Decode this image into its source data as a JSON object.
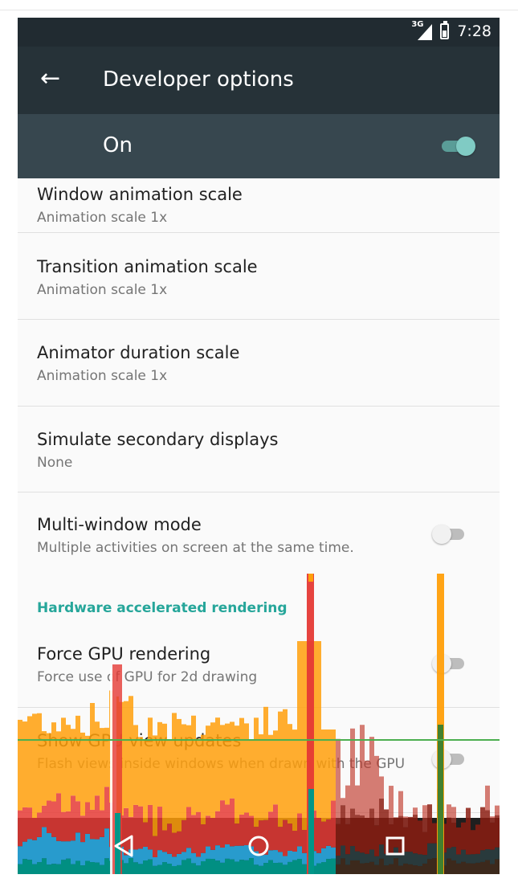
{
  "status_bar": {
    "network": "3G",
    "time": "7:28"
  },
  "app_bar": {
    "title": "Developer options",
    "back_icon": "arrow-back-icon"
  },
  "master_switch": {
    "label": "On",
    "state": "on"
  },
  "settings": [
    {
      "title": "Window animation scale",
      "subtitle": "Animation scale 1x"
    },
    {
      "title": "Transition animation scale",
      "subtitle": "Animation scale 1x"
    },
    {
      "title": "Animator duration scale",
      "subtitle": "Animation scale 1x"
    },
    {
      "title": "Simulate secondary displays",
      "subtitle": "None"
    },
    {
      "title": "Multi-window mode",
      "subtitle": "Multiple activities on screen at the same time.",
      "switch": "off"
    }
  ],
  "section_header": "Hardware accelerated rendering",
  "hw_settings": [
    {
      "title": "Force GPU rendering",
      "subtitle": "Force use of GPU for 2d drawing",
      "switch": "off"
    },
    {
      "title": "Show GPU view updates",
      "subtitle": "Flash views inside windows when drawn with the GPU",
      "switch": "off"
    }
  ],
  "nav_bar": {
    "back": "back-triangle-icon",
    "home": "home-circle-icon",
    "recents": "recents-square-icon"
  },
  "colors": {
    "status_bar": "#212b31",
    "app_bar": "#263238",
    "switch_bar": "#37474f",
    "accent": "#26a69a",
    "gpu_orange": "#ff9f0a",
    "gpu_red": "#e53935",
    "gpu_blue": "#29a8e0",
    "gpu_teal": "#009688",
    "threshold_green": "#4caf50"
  }
}
